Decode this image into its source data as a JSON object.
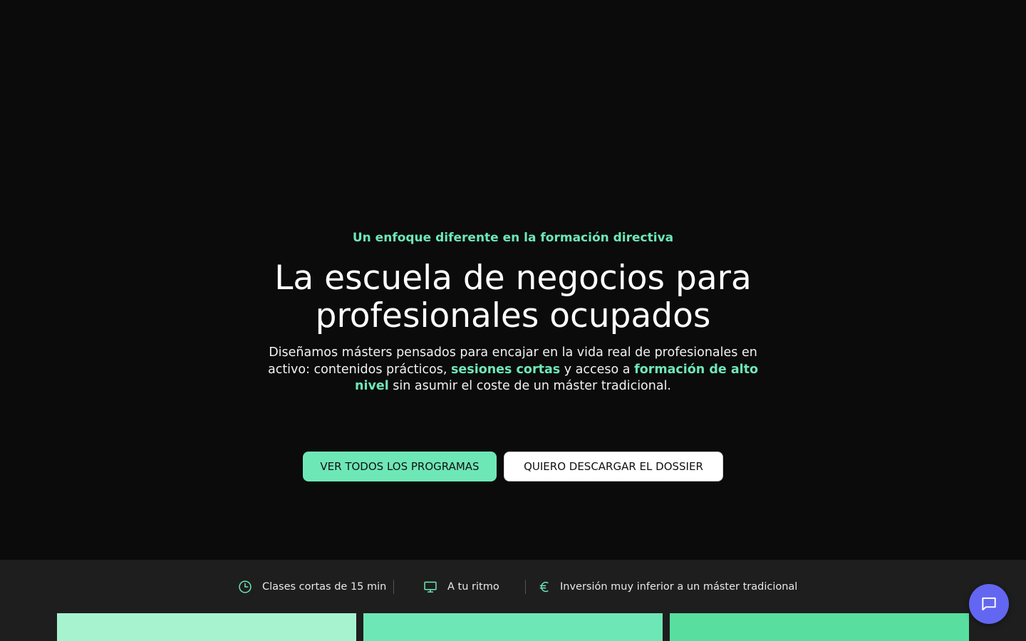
{
  "hero": {
    "eyebrow": "Un enfoque diferente en la formación directiva",
    "title_line1": "La escuela de negocios para",
    "title_line2": "profesionales ocupados",
    "subtitle_part1": "Diseñamos másters pensados para encajar en la vida real de profesionales en activo: contenidos prácticos, ",
    "subtitle_highlight1": "sesiones cortas",
    "subtitle_part2": " y acceso a ",
    "subtitle_highlight2": "formación de alto nivel",
    "subtitle_part3": " sin asumir el coste de un máster tradicional.",
    "primary_button": "VER TODOS LOS PROGRAMAS",
    "secondary_button": "QUIERO DESCARGAR EL DOSSIER"
  },
  "features": [
    {
      "icon": "clock-icon",
      "label": "Clases cortas de 15 min"
    },
    {
      "icon": "monitor-icon",
      "label": "A tu ritmo"
    },
    {
      "icon": "euro-icon",
      "label": "Inversión muy inferior a un máster tradicional"
    }
  ],
  "chat": {
    "icon": "chat-bubble-icon"
  },
  "colors": {
    "accent": "#6ee7b7",
    "background": "#0b0b0b",
    "feature_bar": "#1e1e1e",
    "chat_button": "#6366f1"
  }
}
